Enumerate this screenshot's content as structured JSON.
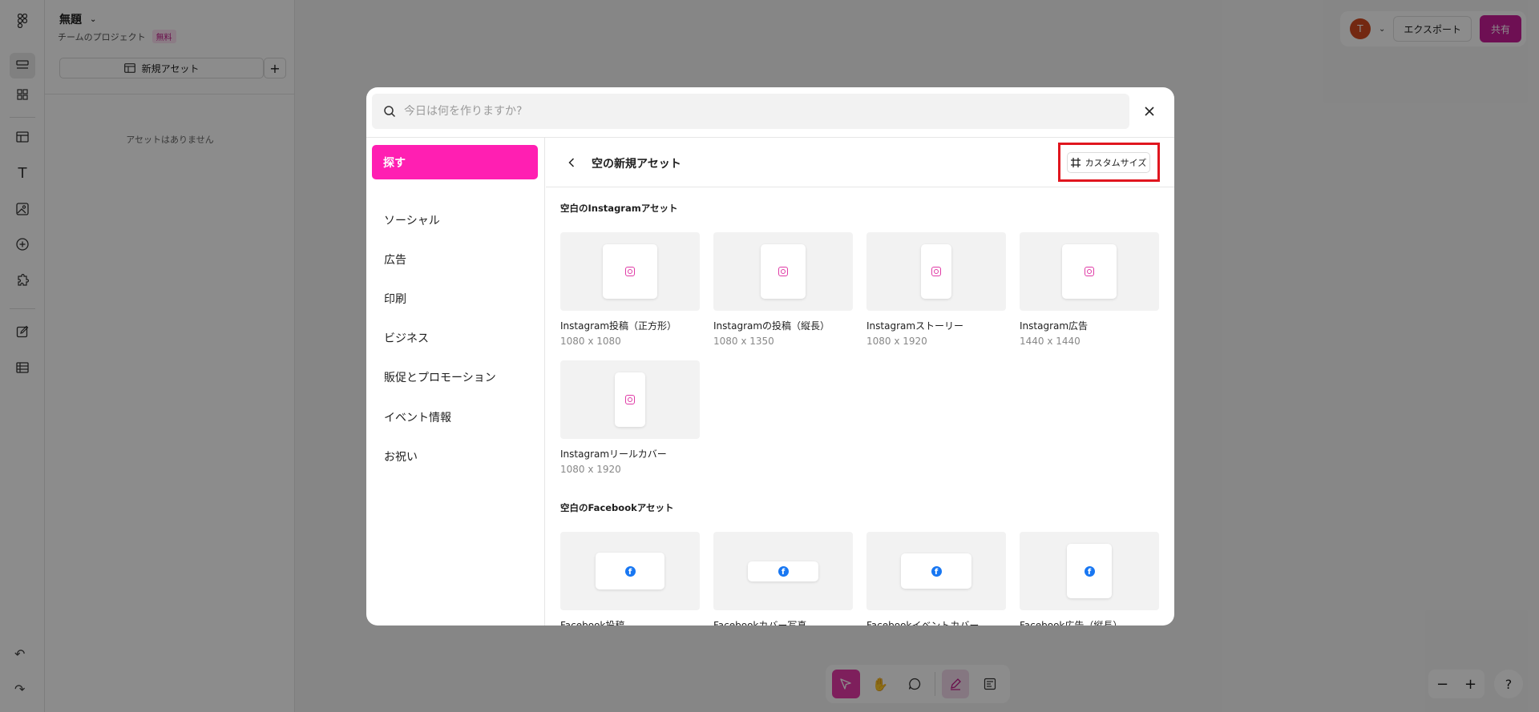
{
  "app": {
    "file_title": "無題",
    "project_label": "チームのプロジェクト",
    "plan_badge": "無料",
    "new_asset_label": "新規アセット",
    "no_assets_text": "アセットはありません",
    "avatar_initial": "T",
    "export_label": "エクスポート",
    "share_label": "共有"
  },
  "modal": {
    "search_placeholder": "今日は何を作りますか?",
    "sidebar": {
      "active": "探す",
      "items": [
        "ソーシャル",
        "広告",
        "印刷",
        "ビジネス",
        "販促とプロモーション",
        "イベント情報",
        "お祝い"
      ]
    },
    "header_title": "空の新規アセット",
    "custom_size_label": "カスタムサイズ",
    "sections": [
      {
        "title": "空白のInstagramアセット",
        "cards": [
          {
            "name": "Instagram投稿（正方形）",
            "size": "1080 x 1080"
          },
          {
            "name": "Instagramの投稿（縦長）",
            "size": "1080 x 1350"
          },
          {
            "name": "Instagramストーリー",
            "size": "1080 x 1920"
          },
          {
            "name": "Instagram広告",
            "size": "1440 x 1440"
          },
          {
            "name": "Instagramリールカバー",
            "size": "1080 x 1920"
          }
        ]
      },
      {
        "title": "空白のFacebookアセット",
        "cards": [
          {
            "name": "Facebook投稿",
            "size": ""
          },
          {
            "name": "Facebookカバー写真",
            "size": ""
          },
          {
            "name": "Facebookイベントカバー",
            "size": ""
          },
          {
            "name": "Facebook広告（縦長）",
            "size": ""
          }
        ]
      }
    ]
  },
  "colors": {
    "accent_pink": "#ff1fb2",
    "share_button": "#c81d97",
    "highlight_red": "#e0161f",
    "instagram_icon": "#e03ba6",
    "facebook_icon": "#1877f2"
  },
  "icons": [
    "figma-logo-icon",
    "chevron-down-icon",
    "layers-icon",
    "assets-grid-icon",
    "layout-icon",
    "text-icon",
    "image-icon",
    "add-circle-icon",
    "plugin-icon",
    "edit-icon",
    "table-icon",
    "undo-icon",
    "redo-icon",
    "search-icon",
    "close-icon",
    "back-chevron-icon",
    "frame-icon",
    "instagram-icon",
    "facebook-icon",
    "cursor-icon",
    "hand-icon",
    "comment-icon",
    "draw-icon",
    "dev-mode-icon",
    "zoom-out-icon",
    "zoom-in-icon",
    "help-icon"
  ]
}
